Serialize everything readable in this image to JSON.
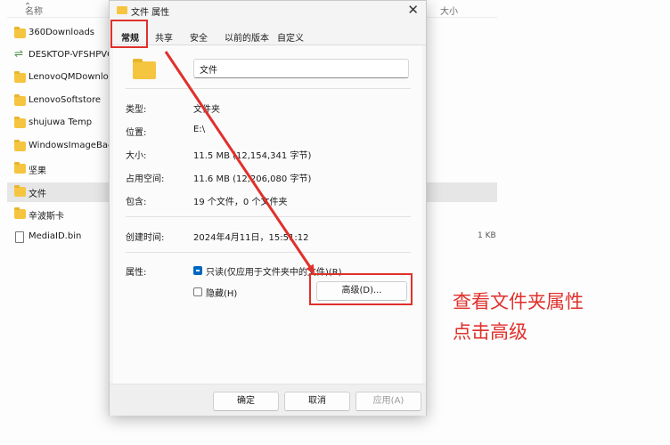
{
  "explorer": {
    "columns": {
      "name": "名称",
      "size": "大小"
    },
    "files": [
      {
        "name": "360Downloads",
        "icon": "folder-icon",
        "size": ""
      },
      {
        "name": "DESKTOP-VFSHPVC",
        "icon": "network-computer-icon",
        "size": ""
      },
      {
        "name": "LenovoQMDownload",
        "icon": "folder-icon",
        "size": ""
      },
      {
        "name": "LenovoSoftstore",
        "icon": "folder-icon",
        "size": ""
      },
      {
        "name": "shujuwa Temp",
        "icon": "folder-icon",
        "size": ""
      },
      {
        "name": "WindowsImageBack",
        "icon": "folder-icon",
        "size": ""
      },
      {
        "name": "坚果",
        "icon": "folder-icon",
        "size": ""
      },
      {
        "name": "文件",
        "icon": "folder-icon",
        "size": "",
        "selected": true
      },
      {
        "name": "辛波斯卡",
        "icon": "folder-icon",
        "size": ""
      },
      {
        "name": "MediaID.bin",
        "icon": "file-icon",
        "size": "1 KB"
      }
    ]
  },
  "dialog": {
    "title": "文件 属性",
    "close_glyph": "✕",
    "tabs": [
      "常规",
      "共享",
      "安全",
      "以前的版本",
      "自定义"
    ],
    "active_tab": "常规",
    "folder_name": "文件",
    "fields": {
      "type_label": "类型:",
      "type_value": "文件夹",
      "location_label": "位置:",
      "location_value": "E:\\",
      "size_label": "大小:",
      "size_value": "11.5 MB (12,154,341 字节)",
      "disk_size_label": "占用空间:",
      "disk_size_value": "11.6 MB (12,206,080 字节)",
      "contains_label": "包含:",
      "contains_value": "19 个文件，0 个文件夹",
      "created_label": "创建时间:",
      "created_value": "2024年4月11日，15:51:12",
      "attributes_label": "属性:"
    },
    "attributes": {
      "readonly_label": "只读(仅应用于文件夹中的文件)(R)",
      "readonly_state": "indeterminate",
      "hidden_label": "隐藏(H)",
      "hidden_state": "unchecked",
      "advanced_button": "高级(D)..."
    },
    "buttons": {
      "ok": "确定",
      "cancel": "取消",
      "apply": "应用(A)"
    }
  },
  "annotation": {
    "text_line1": "查看文件夹属性",
    "text_line2": "点击高级",
    "color": "#e0302b"
  },
  "colors": {
    "folder": "#f5c540",
    "selection": "#e6e6e6",
    "checkbox_accent": "#0067c0"
  }
}
